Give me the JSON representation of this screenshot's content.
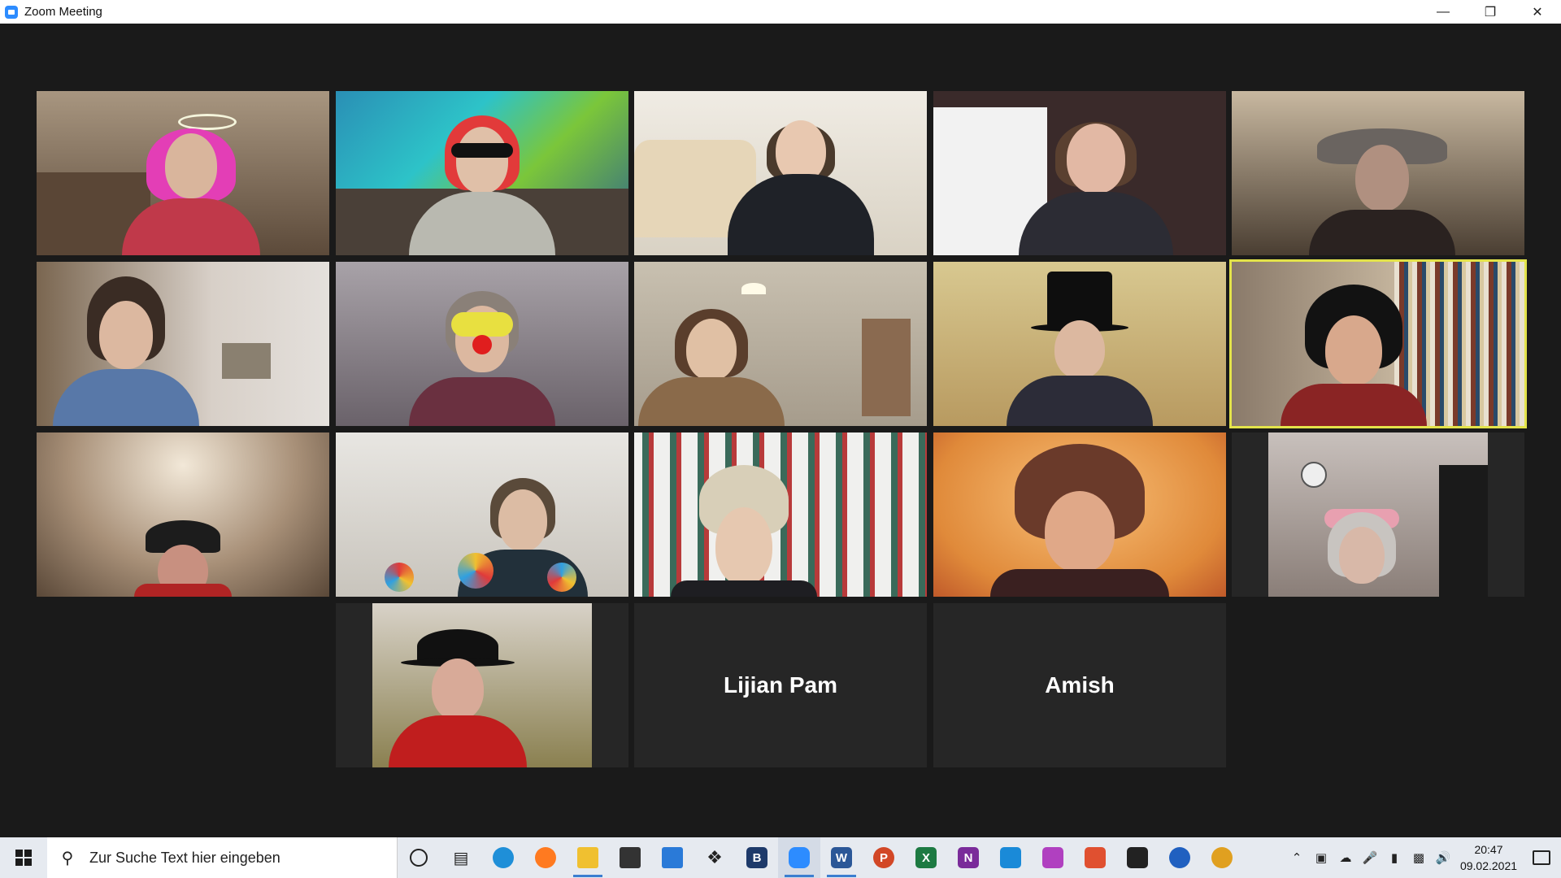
{
  "window": {
    "title": "Zoom Meeting",
    "controls": [
      "minimize",
      "restore",
      "close"
    ]
  },
  "colors": {
    "background": "#1a1a1a",
    "tile_empty": "#262626",
    "active_speaker_border": "#e3e34a",
    "taskbar": "#e6eaf0",
    "zoom_blue": "#2d8cff"
  },
  "gallery": {
    "layout": "gallery",
    "active_speaker_tile": 10,
    "tiles": [
      {
        "id": 1,
        "type": "video",
        "scene": "pink wig, halo, drinking"
      },
      {
        "id": 2,
        "type": "video",
        "scene": "red hair, sunglasses, graffiti background"
      },
      {
        "id": 3,
        "type": "video",
        "scene": "woman resting head on hand, sofa"
      },
      {
        "id": 4,
        "type": "video",
        "scene": "woman with glasses and headphones"
      },
      {
        "id": 5,
        "type": "video",
        "scene": "pirate hat, dim room"
      },
      {
        "id": 6,
        "type": "video",
        "scene": "woman with glasses, blue sweater"
      },
      {
        "id": 7,
        "type": "video",
        "scene": "clown nose, yellow glasses"
      },
      {
        "id": 8,
        "type": "video",
        "scene": "woman looking down, lamp"
      },
      {
        "id": 9,
        "type": "video",
        "scene": "top hat, glasses"
      },
      {
        "id": 10,
        "type": "video",
        "scene": "black wig, bookshelf",
        "active": true
      },
      {
        "id": 11,
        "type": "video",
        "scene": "woman with hat, arched room"
      },
      {
        "id": 12,
        "type": "video",
        "scene": "lollipops"
      },
      {
        "id": 13,
        "type": "video",
        "scene": "blond hair, bookshelf"
      },
      {
        "id": 14,
        "type": "video",
        "scene": "woman with hand at mouth, orange light"
      },
      {
        "id": 15,
        "type": "video",
        "scene": "flower headband, clock"
      },
      {
        "id": 16,
        "type": "video",
        "scene": "black hat, red sweater"
      },
      {
        "id": 17,
        "type": "name",
        "name": "Lijian Pam"
      },
      {
        "id": 18,
        "type": "name",
        "name": "Amish"
      }
    ]
  },
  "taskbar": {
    "search_placeholder": "Zur Suche Text hier eingeben",
    "apps": [
      {
        "name": "cortana",
        "label": ""
      },
      {
        "name": "task-view",
        "label": ""
      },
      {
        "name": "edge",
        "label": ""
      },
      {
        "name": "firefox",
        "label": ""
      },
      {
        "name": "file-explorer",
        "label": ""
      },
      {
        "name": "store",
        "label": ""
      },
      {
        "name": "mail",
        "label": ""
      },
      {
        "name": "dropbox",
        "label": ""
      },
      {
        "name": "b-app",
        "label": "B"
      },
      {
        "name": "zoom",
        "label": ""
      },
      {
        "name": "word",
        "label": "W"
      },
      {
        "name": "powerpoint",
        "label": "P"
      },
      {
        "name": "excel",
        "label": "X"
      },
      {
        "name": "onenote",
        "label": "N"
      },
      {
        "name": "affinity-designer",
        "label": ""
      },
      {
        "name": "affinity-photo",
        "label": ""
      },
      {
        "name": "affinity-publisher",
        "label": ""
      },
      {
        "name": "davinci-resolve",
        "label": ""
      },
      {
        "name": "audio-app",
        "label": ""
      },
      {
        "name": "tool-app",
        "label": ""
      }
    ],
    "tray_icons": [
      "chevron-up",
      "meet-now",
      "onedrive",
      "microphone",
      "battery",
      "network",
      "volume"
    ],
    "time": "20:47",
    "date": "09.02.2021"
  }
}
